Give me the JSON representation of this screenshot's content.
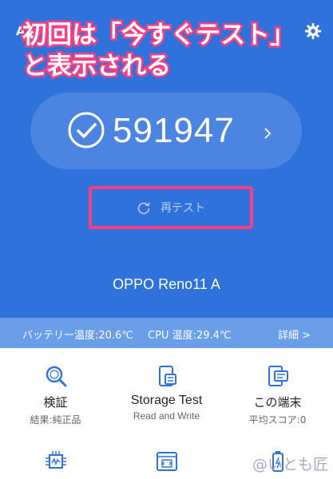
{
  "status": {
    "left_text": "A"
  },
  "overlay": {
    "line1": "初回は「今すぐテスト」",
    "line2": "と表示される"
  },
  "score": {
    "value": "591947"
  },
  "retest": {
    "label": "再テスト"
  },
  "device": {
    "name": "OPPO Reno11 A"
  },
  "temps": {
    "battery": "バッテリー温度:20.6℃",
    "cpu": "CPU 温度:29.4℃",
    "details": "詳細 >"
  },
  "tiles": [
    {
      "title": "検証",
      "sub": "結果:純正品",
      "icon": "magnifier-icon"
    },
    {
      "title": "Storage Test",
      "sub": "Read and Write",
      "icon": "storage-icon"
    },
    {
      "title": "この端末",
      "sub": "平均スコア:0",
      "icon": "device-info-icon"
    }
  ],
  "tiles_row2": [
    {
      "icon": "chip-icon"
    },
    {
      "icon": "browser-icon"
    },
    {
      "icon": "battery-icon"
    }
  ],
  "watermark": {
    "text": "@いとも匠"
  },
  "colors": {
    "hero": "#2f72dc",
    "temp_bar": "#6a9ee8",
    "highlight": "#ff3f82",
    "icon_blue": "#2f72dc"
  }
}
